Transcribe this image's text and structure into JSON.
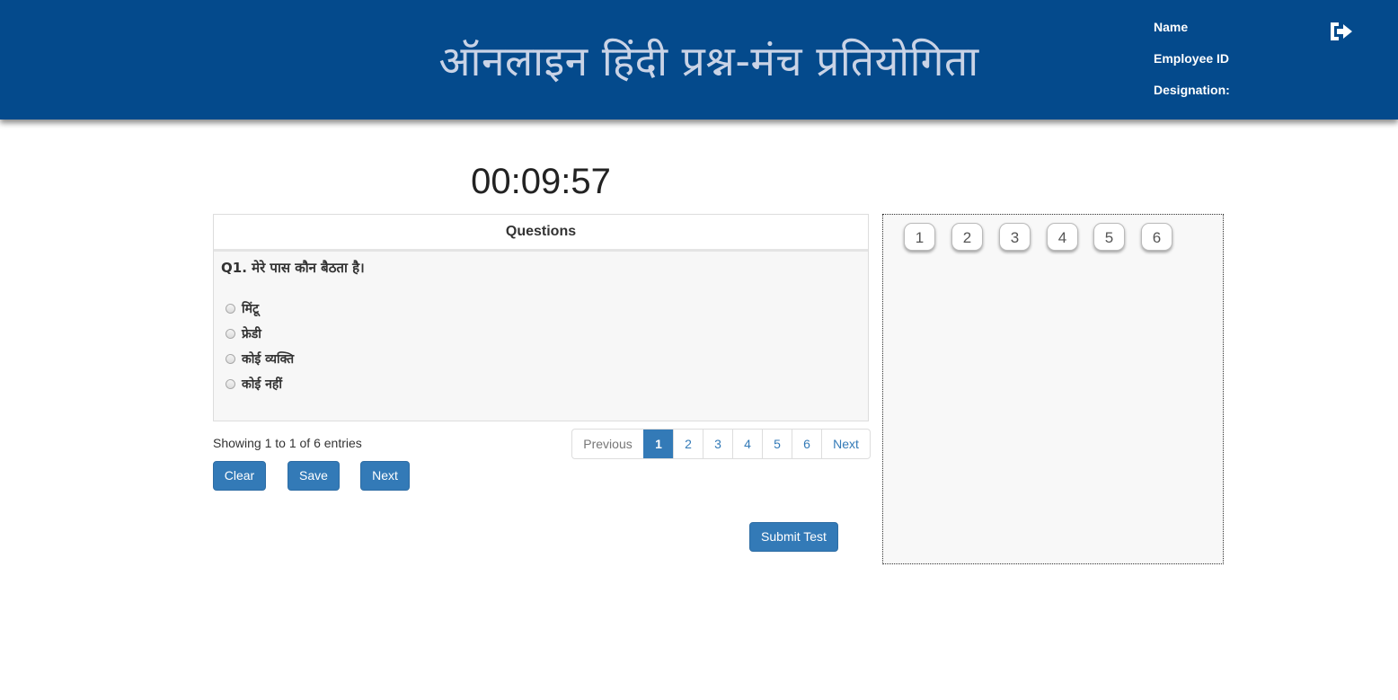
{
  "header": {
    "title": "ऑनलाइन हिंदी प्रश्न-मंच प्रतियोगिता",
    "name_label": "Name",
    "name_value": "",
    "employee_id_label": "Employee ID",
    "employee_id_value": "",
    "designation_label": "Designation:",
    "designation_value": "",
    "logout_icon": "sign-out-icon"
  },
  "timer": "00:09:57",
  "questions": {
    "heading": "Questions",
    "question_text": "Q1. मेरे पास कौन बैठता है।",
    "options": [
      "मिंटू",
      "फ्रेडी",
      "कोई व्यक्ति",
      "कोई नहीं"
    ]
  },
  "pagination": {
    "showing": "Showing 1 to 1 of 6 entries",
    "previous": "Previous",
    "pages": [
      "1",
      "2",
      "3",
      "4",
      "5",
      "6"
    ],
    "active_page": "1",
    "next": "Next"
  },
  "buttons": {
    "clear": "Clear",
    "save": "Save",
    "next": "Next",
    "submit": "Submit Test"
  },
  "question_nav": [
    "1",
    "2",
    "3",
    "4",
    "5",
    "6"
  ],
  "colors": {
    "header_bg": "#044a8c",
    "primary": "#337ab7"
  }
}
